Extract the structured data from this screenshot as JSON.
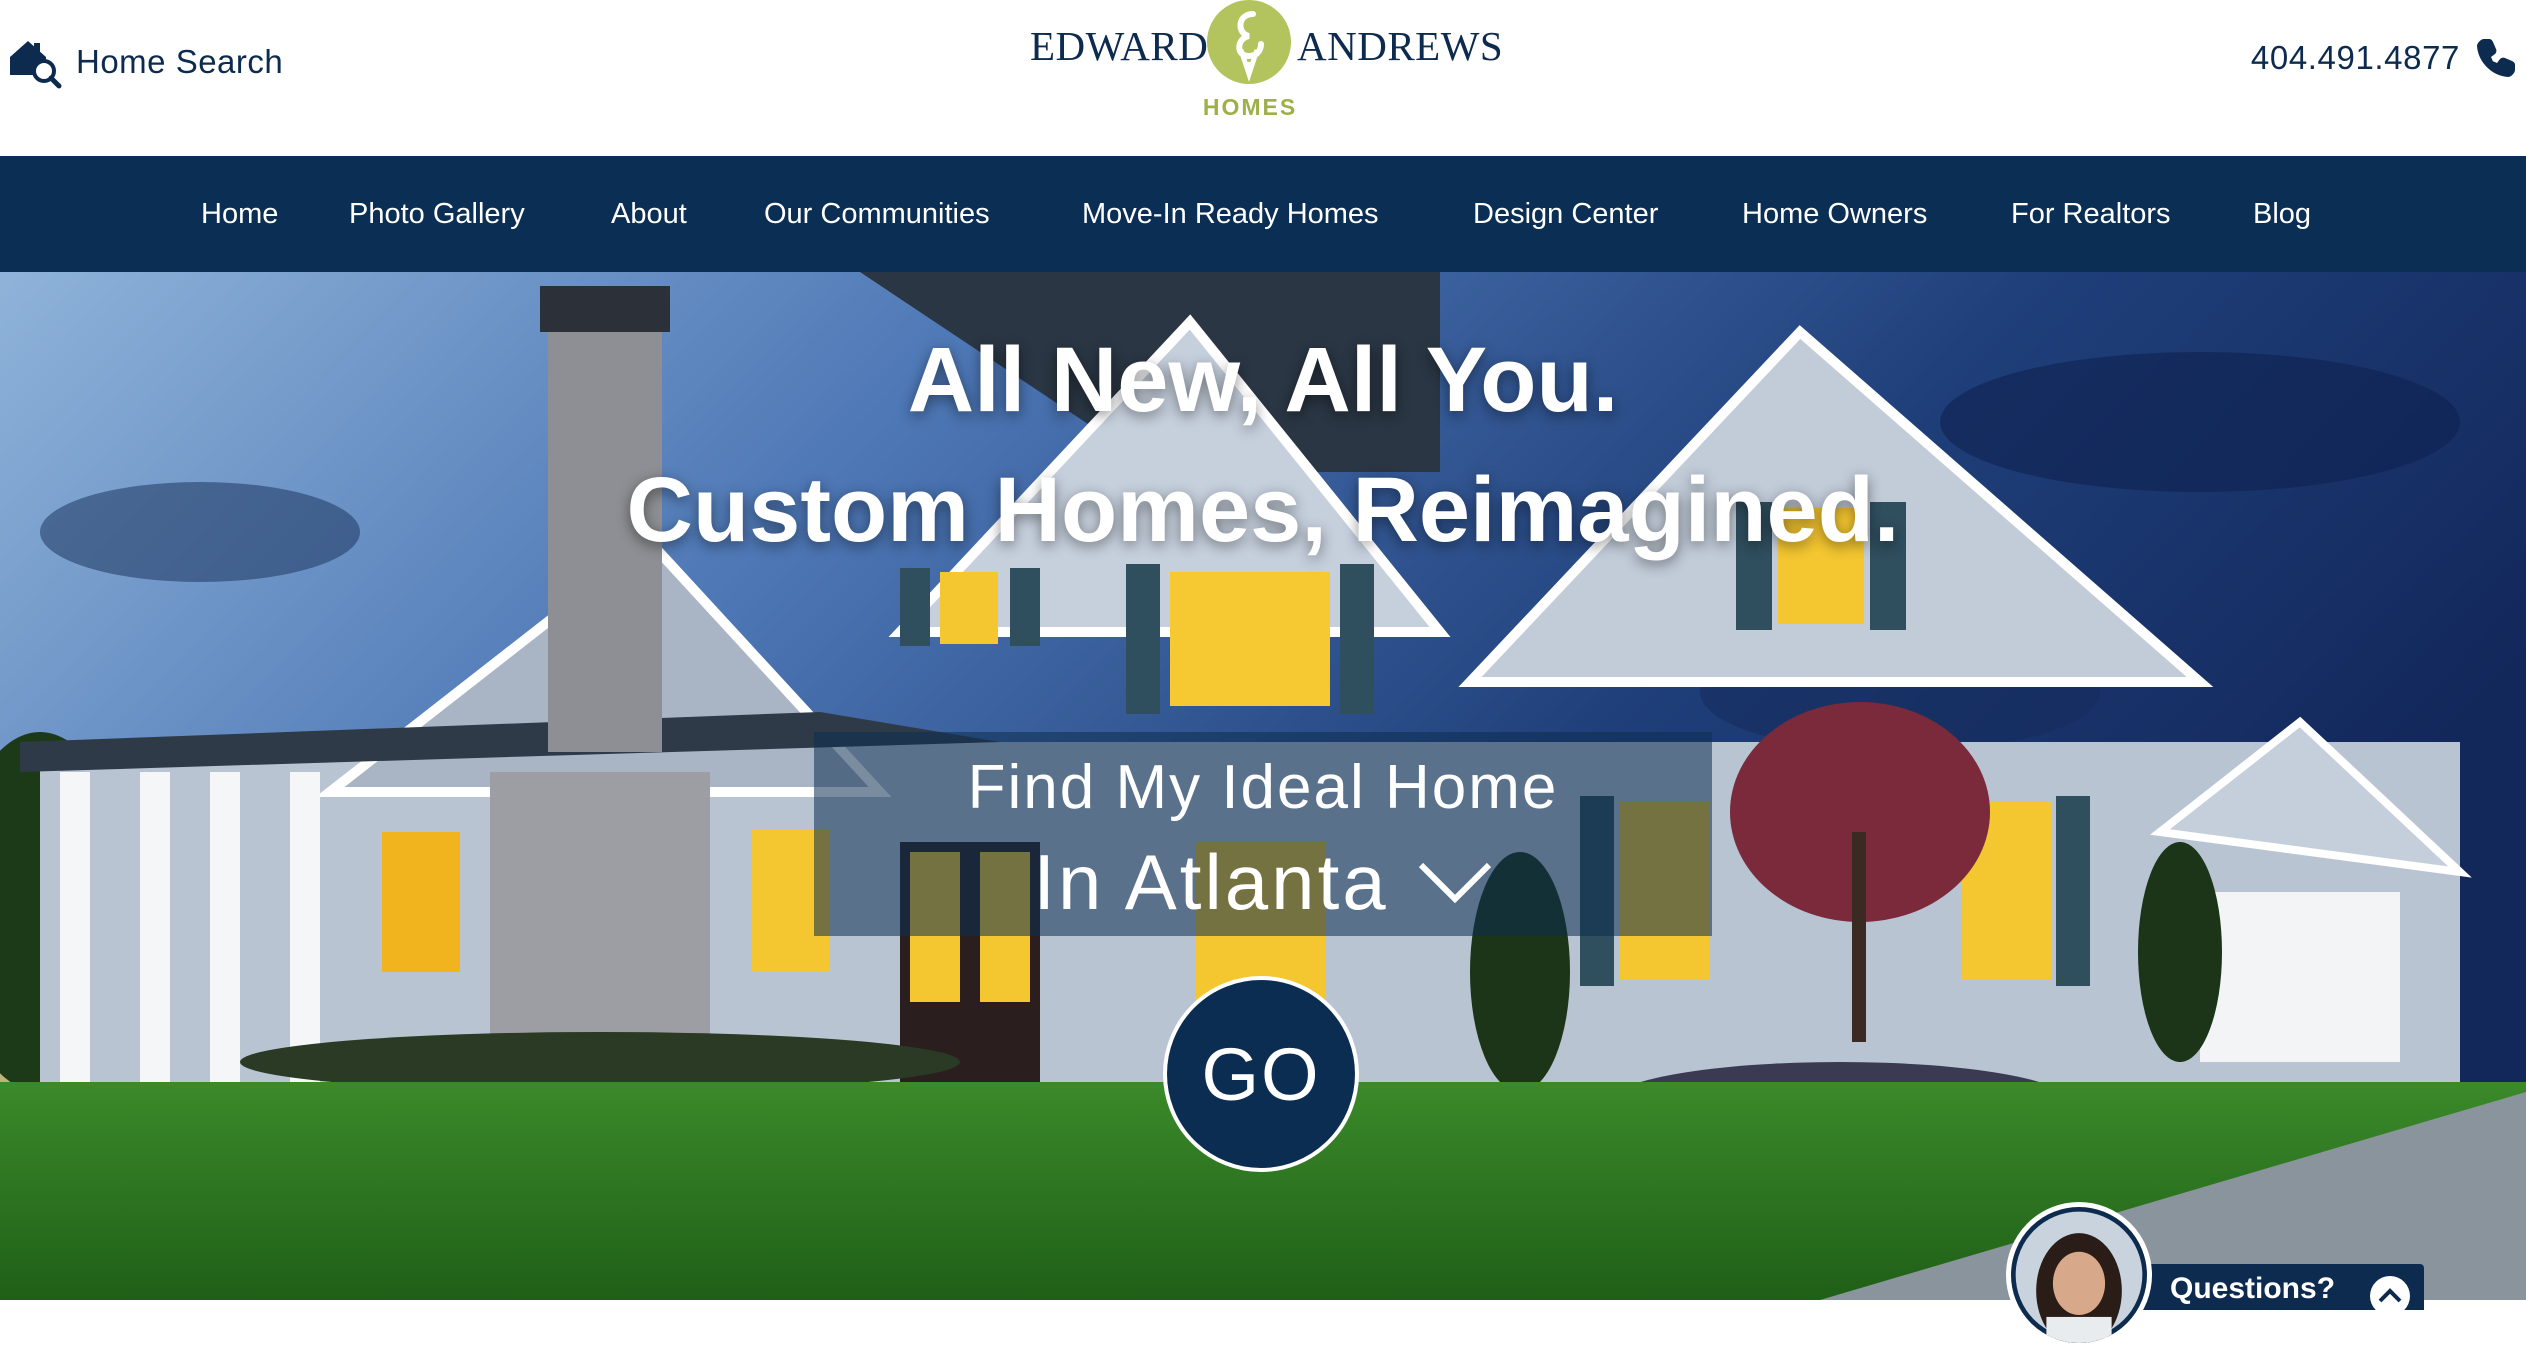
{
  "header": {
    "home_search_label": "Home Search",
    "phone_number": "404.491.4877",
    "logo": {
      "name_left": "EDWARD",
      "name_right": "ANDREWS",
      "sub": "HOMES"
    }
  },
  "nav": {
    "items": [
      {
        "label": "Home"
      },
      {
        "label": "Photo Gallery"
      },
      {
        "label": "About"
      },
      {
        "label": "Our Communities"
      },
      {
        "label": "Move-In Ready Homes"
      },
      {
        "label": "Design Center"
      },
      {
        "label": "Home Owners"
      },
      {
        "label": "For Realtors"
      },
      {
        "label": "Blog"
      }
    ]
  },
  "hero": {
    "headline_1": "All New, All You.",
    "headline_2": "Custom Homes, Reimagined.",
    "finder_label": "Find My Ideal Home",
    "location_selected": "In Atlanta",
    "go_label": "GO"
  },
  "chat": {
    "label": "Questions?"
  },
  "icons": {
    "home_search": "home-search-icon",
    "phone": "phone-icon",
    "dropdown": "chevron-down-icon",
    "chat_toggle": "chevron-up-icon"
  },
  "colors": {
    "navy": "#0b2e54",
    "brand_green": "#b3c35d",
    "white": "#ffffff"
  }
}
